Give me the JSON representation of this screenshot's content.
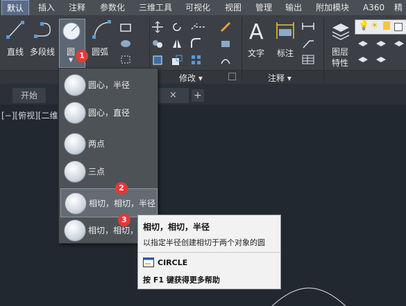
{
  "ribbon_tabs": [
    "默认",
    "插入",
    "注释",
    "参数化",
    "三维工具",
    "可视化",
    "视图",
    "管理",
    "输出",
    "附加模块",
    "A360",
    "精"
  ],
  "draw_panel": {
    "line_label": "直线",
    "polyline_label": "多段线",
    "circle_label": "圆",
    "arc_label": "圆弧"
  },
  "annotation_panel": {
    "text_label": "文字",
    "dimension_label": "标注"
  },
  "layer_panel": {
    "layer_label_line1": "图层",
    "layer_label_line2": "特性"
  },
  "panel_labels": {
    "modify": "修改 ▾",
    "annotation": "注释 ▾"
  },
  "doc_tabs": {
    "start": "开始",
    "close_glyph": "×",
    "add_glyph": "+"
  },
  "viewport_label": "[−][俯视][二维线",
  "circle_menu": {
    "items": [
      {
        "label": "圆心，半径"
      },
      {
        "label": "圆心，直径"
      },
      {
        "label": "两点"
      },
      {
        "label": "三点"
      },
      {
        "label": "相切，相切，半径"
      },
      {
        "label": "相切，相切，相"
      }
    ]
  },
  "badges": [
    "1",
    "2",
    "3"
  ],
  "tooltip": {
    "title": "相切，相切，半径",
    "description": "以指定半径创建相切于两个对象的圆",
    "command": "CIRCLE",
    "help": "按 F1 键获得更多帮助"
  },
  "colors": {
    "background": "#212830",
    "ribbon": "#3c4046",
    "active_tab": "#5b6a86",
    "badge": "#e53935",
    "tooltip_bg": "#f2f2f2"
  }
}
